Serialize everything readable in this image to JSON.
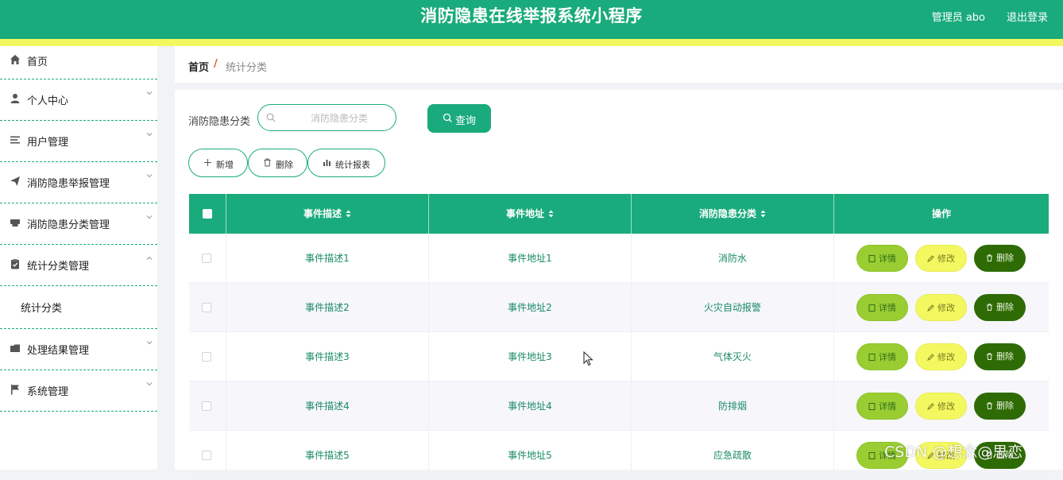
{
  "header": {
    "title": "消防隐患在线举报系统小程序",
    "user": "管理员 abo",
    "logout": "退出登录"
  },
  "colors": {
    "primary": "#1aab7c",
    "accent_yellow": "#f3f860",
    "detail_green": "#9acd32",
    "delete_dark_green": "#2e6b04"
  },
  "sidebar": {
    "items": [
      {
        "label": "首页",
        "icon": "home-icon"
      },
      {
        "label": "个人中心",
        "icon": "user-icon"
      },
      {
        "label": "用户管理",
        "icon": "list-icon"
      },
      {
        "label": "消防隐患举报管理",
        "icon": "send-icon"
      },
      {
        "label": "消防隐患分类管理",
        "icon": "printer-icon"
      },
      {
        "label": "统计分类管理",
        "icon": "clipboard-icon"
      },
      {
        "label": "处理结果管理",
        "icon": "folder-icon"
      },
      {
        "label": "系统管理",
        "icon": "flag-icon"
      }
    ],
    "sub_item": "统计分类"
  },
  "breadcrumb": {
    "home": "首页",
    "separator": "/",
    "current": "统计分类"
  },
  "search": {
    "label": "消防隐患分类",
    "placeholder": "消防隐患分类",
    "button": "查询"
  },
  "actions": {
    "add": "新增",
    "delete": "删除",
    "report": "统计报表"
  },
  "table": {
    "columns": [
      "事件描述",
      "事件地址",
      "消防隐患分类",
      "操作"
    ],
    "row_buttons": {
      "detail": "详情",
      "edit": "修改",
      "delete": "删除"
    },
    "rows": [
      {
        "desc": "事件描述1",
        "addr": "事件地址1",
        "category": "消防水"
      },
      {
        "desc": "事件描述2",
        "addr": "事件地址2",
        "category": "火灾自动报警"
      },
      {
        "desc": "事件描述3",
        "addr": "事件地址3",
        "category": "气体灭火"
      },
      {
        "desc": "事件描述4",
        "addr": "事件地址4",
        "category": "防排烟"
      },
      {
        "desc": "事件描述5",
        "addr": "事件地址5",
        "category": "应急疏散"
      }
    ]
  },
  "watermark": "CSDN @想念@思恋"
}
